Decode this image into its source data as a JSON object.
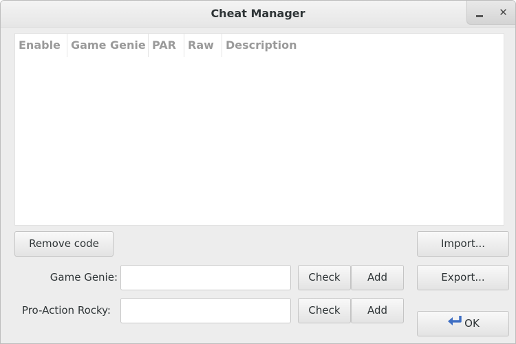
{
  "window": {
    "title": "Cheat Manager",
    "minimize_glyph": "_",
    "close_glyph": "✕"
  },
  "cheat_list": {
    "columns": [
      "Enable",
      "Game Genie",
      "PAR",
      "Raw",
      "Description"
    ],
    "rows": []
  },
  "buttons": {
    "remove_code": "Remove code",
    "import": "Import...",
    "export": "Export...",
    "ok": "OK"
  },
  "game_genie": {
    "label": "Game Genie:",
    "value": "",
    "check": "Check",
    "add": "Add"
  },
  "pro_action_rocky": {
    "label": "Pro-Action Rocky:",
    "value": "",
    "check": "Check",
    "add": "Add"
  },
  "icons": {
    "ok": "return-arrow-icon",
    "ok_color": "#3f6fc4"
  }
}
